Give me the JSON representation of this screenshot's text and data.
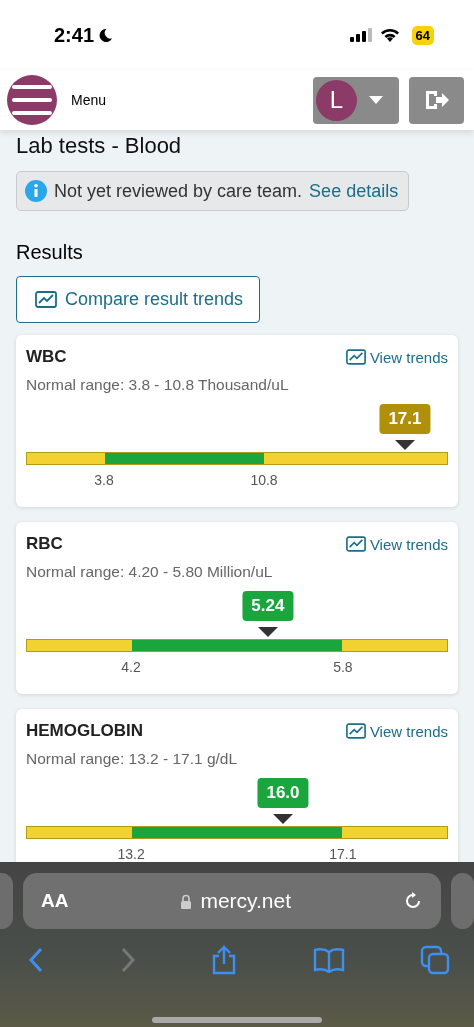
{
  "status_bar": {
    "time": "2:41",
    "battery": "64"
  },
  "header": {
    "menu_label": "Menu",
    "avatar_initial": "L"
  },
  "page_title": "Lab tests - Blood",
  "notice": {
    "text": "Not yet reviewed by care team.",
    "link": "See details"
  },
  "results_heading": "Results",
  "compare_button": "Compare result trends",
  "results": [
    {
      "name": "WBC",
      "trend_link": "View trends",
      "range": "Normal range: 3.8 - 10.8 Thousand/uL",
      "value": "17.1",
      "kind": "high",
      "level": 0.898,
      "segments": [
        {
          "kind": "low",
          "level": 0.185
        },
        {
          "kind": "normal",
          "level": 0.379
        },
        {
          "kind": "high",
          "level": 0.436
        }
      ],
      "ticks": [
        "3.8",
        "10.8"
      ]
    },
    {
      "name": "RBC",
      "trend_link": "View trends",
      "range": "Normal range: 4.20 - 5.80 Million/uL",
      "value": "5.24",
      "kind": "normal",
      "level": 0.573,
      "segments": [
        {
          "kind": "low",
          "level": 0.249
        },
        {
          "kind": "normal",
          "level": 0.502
        },
        {
          "kind": "high",
          "level": 0.249
        }
      ],
      "ticks": [
        "4.2",
        "5.8"
      ]
    },
    {
      "name": "HEMOGLOBIN",
      "trend_link": "View trends",
      "range": "Normal range: 13.2 - 17.1 g/dL",
      "value": "16.0",
      "kind": "normal",
      "level": 0.609,
      "segments": [
        {
          "kind": "low",
          "level": 0.249
        },
        {
          "kind": "normal",
          "level": 0.502
        },
        {
          "kind": "high",
          "level": 0.249
        }
      ],
      "ticks": [
        "13.2",
        "17.1"
      ]
    }
  ],
  "browser": {
    "text_size_button": "AA",
    "url": "mercy.net",
    "back_enabled": true,
    "forward_enabled": false
  }
}
